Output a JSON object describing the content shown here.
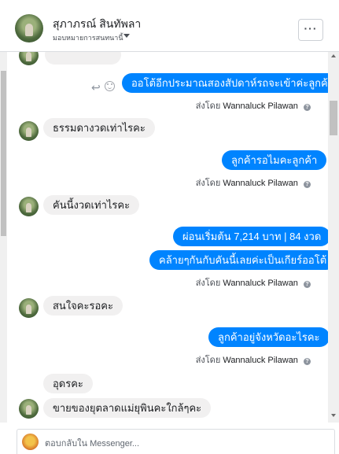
{
  "header": {
    "name": "สุภาภรณ์ สินทัพลา",
    "subtitle": "มอบหมายการสนทนานี้",
    "more_label": "···"
  },
  "messages": [
    {
      "dir": "in",
      "text": ""
    },
    {
      "dir": "out",
      "text": "ออโต้อีกประมาณสองสัปดาห์รถจะเข้าค่ะลูกค้า"
    },
    {
      "dir": "in",
      "text": "ธรรมดางวดเท่าไรคะ"
    },
    {
      "dir": "out",
      "text": "ลูกค้ารอไมคะลูกค้า"
    },
    {
      "dir": "in",
      "text": "คันนี้งวดเท่าไรคะ"
    },
    {
      "dir": "out",
      "text": "ผ่อนเริ่มต้น 7,214 บาท | 84 งวด"
    },
    {
      "dir": "out",
      "text": "คล้ายๆกันกับคันนี้เลยค่ะเป็นเกียร์ออโต้"
    },
    {
      "dir": "in",
      "text": "สนใจคะรอคะ"
    },
    {
      "dir": "out",
      "text": "ลูกค้าอยู่จังหวัดอะไรคะ"
    },
    {
      "dir": "in",
      "text": "อุดรคะ"
    },
    {
      "dir": "in",
      "text": "ขายของยุตลาดแม่ยุพินคะใกล้ๆคะ"
    }
  ],
  "sent_by": {
    "prefix": "ส่งโดย",
    "agent": "Wannaluck Pilawan",
    "help": "?"
  },
  "composer": {
    "placeholder": "ตอบกลับใน Messenger..."
  },
  "colors": {
    "outgoing_bubble": "#0084ff",
    "incoming_bubble": "#f1f0f0"
  },
  "icons": [
    "reply-icon",
    "smile-icon",
    "more-icon",
    "caret-down-icon",
    "help-icon"
  ]
}
